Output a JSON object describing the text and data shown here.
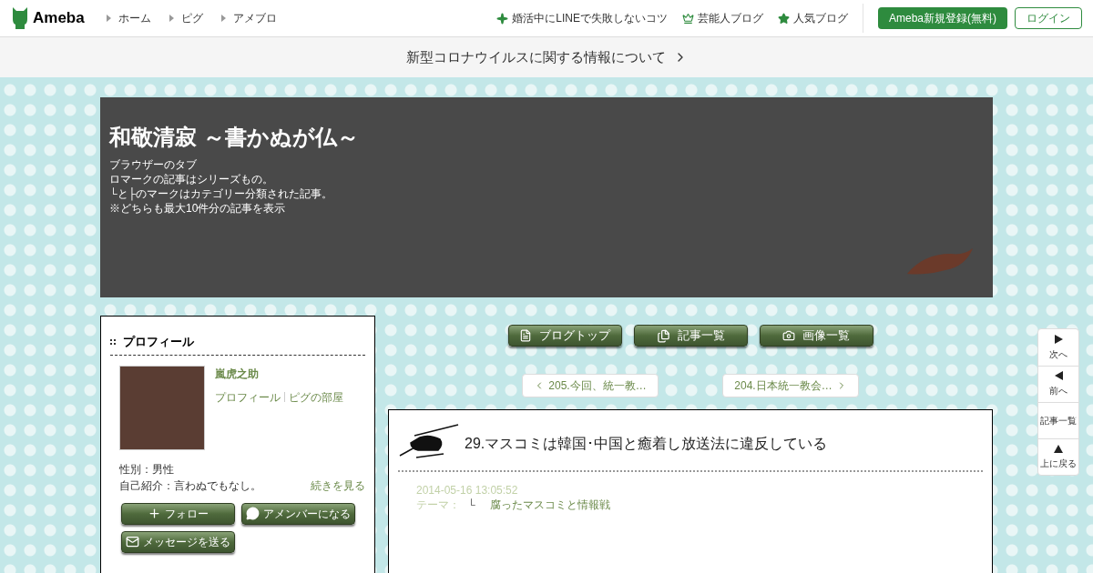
{
  "header": {
    "logo": "Ameba",
    "breadcrumbs": [
      "ホーム",
      "ピグ",
      "アメブロ"
    ],
    "links": [
      {
        "kind": "sparkle",
        "label": "婚活中にLINEで失敗しないコツ"
      },
      {
        "kind": "crown",
        "label": "芸能人ブログ"
      },
      {
        "kind": "star",
        "label": "人気ブログ"
      }
    ],
    "signup": "Ameba新規登録(無料)",
    "login": "ログイン"
  },
  "notice": {
    "text": "新型コロナウイルスに関する情報について"
  },
  "blog_header": {
    "title": "和敬清寂 ～書かぬが仏～",
    "lines": [
      "ブラウザーのタブ",
      "ロマークの記事はシリーズもの。",
      "└と├のマークはカテゴリー分類された記事。",
      "※どちらも最大10件分の記事を表示"
    ]
  },
  "profile": {
    "heading": "プロフィール",
    "name": "嵐虎之助",
    "links": [
      "プロフィール",
      "ピグの部屋"
    ],
    "gender": "性別：男性",
    "intro": "自己紹介：言わぬでもなし。",
    "more": "続きを見る",
    "buttons": [
      {
        "kind": "plus",
        "label": "フォロー"
      },
      {
        "kind": "chat",
        "label": "アメンバーになる"
      },
      {
        "kind": "mail",
        "label": "メッセージを送る"
      }
    ]
  },
  "blog_nav": [
    {
      "kind": "list",
      "label": "ブログトップ"
    },
    {
      "kind": "pages",
      "label": "記事一覧"
    },
    {
      "kind": "camera",
      "label": "画像一覧"
    }
  ],
  "pager": {
    "prev": "205.今回、統一教…",
    "next": "204.日本統一教会…"
  },
  "article": {
    "title": "29.マスコミは韓国･中国と癒着し放送法に違反している",
    "date": "2014-05-16 13:05:52",
    "theme_label": "テーマ：",
    "theme_mark": "└",
    "theme": "腐ったマスコミと情報戦"
  },
  "side_nav": [
    {
      "kind": "next",
      "label": "次へ"
    },
    {
      "kind": "prev",
      "label": "前へ"
    },
    {
      "kind": "none",
      "label": "記事一覧"
    },
    {
      "kind": "up",
      "label": "上に戻る"
    }
  ]
}
